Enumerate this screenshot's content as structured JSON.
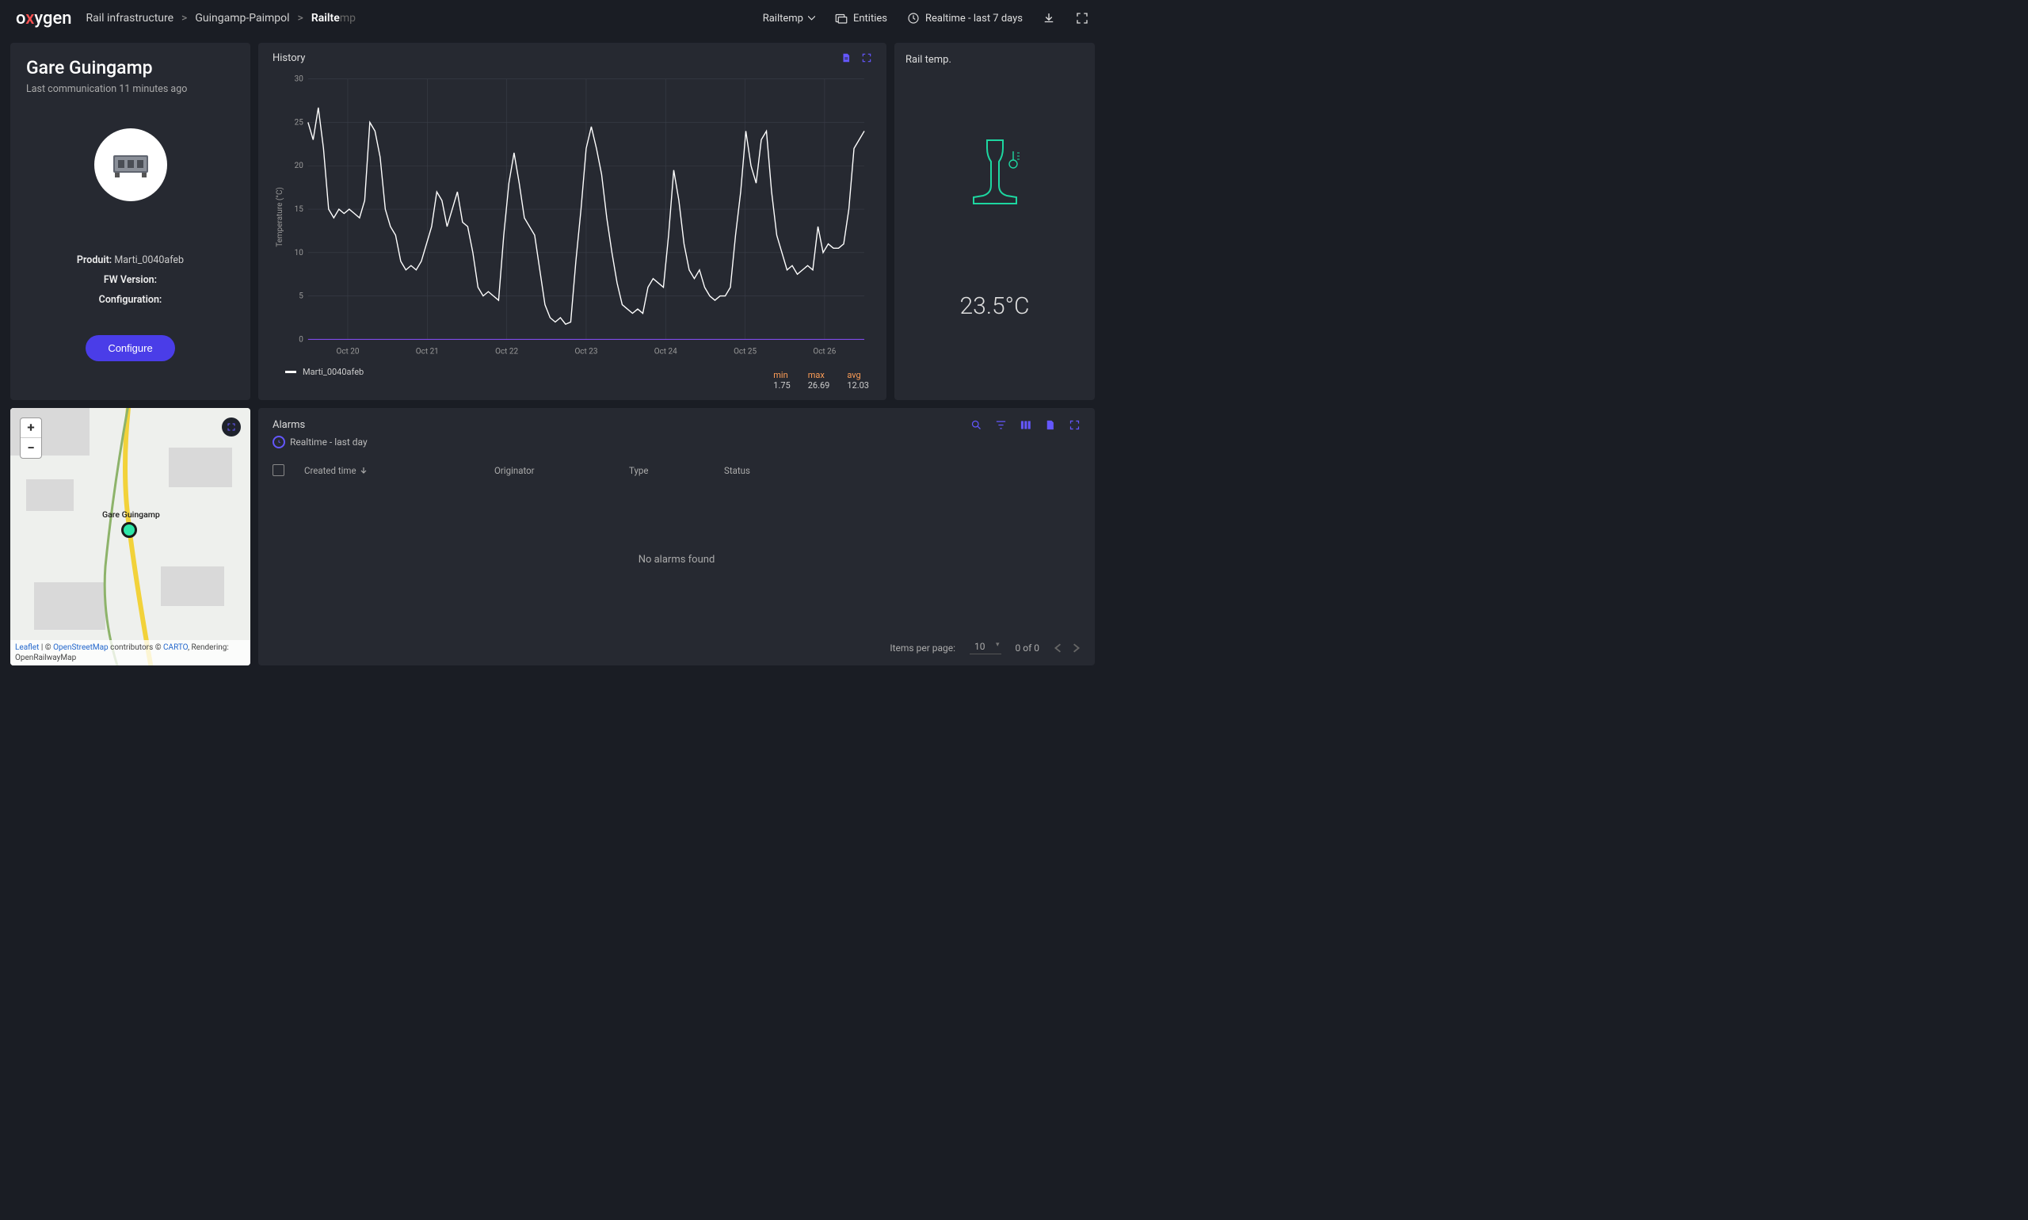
{
  "header": {
    "logo_o1": "o",
    "logo_x": "x",
    "logo_rest": "ygen",
    "crumb1": "Rail infrastructure",
    "crumb2": "Guingamp-Paimpol",
    "crumb3_strong": "Railte",
    "crumb3_faded": "mp",
    "entity_dropdown": "Railtemp",
    "entities_label": "Entities",
    "time_label": "Realtime - last 7 days"
  },
  "info": {
    "title": "Gare Guingamp",
    "subtitle": "Last communication 11 minutes ago",
    "product_label": "Produit:",
    "product_val": "Marti_0040afeb",
    "fw_label": "FW Version:",
    "conf_label": "Configuration:",
    "configure_btn": "Configure"
  },
  "chart": {
    "title": "History",
    "ylabel": "Temperature (°C)",
    "series_name": "Marti_0040afeb",
    "stats": {
      "min_label": "min",
      "min_val": "1.75",
      "max_label": "max",
      "max_val": "26.69",
      "avg_label": "avg",
      "avg_val": "12.03"
    }
  },
  "gauge": {
    "title": "Rail temp.",
    "value": "23.5°C"
  },
  "map": {
    "marker_label": "Gare Guingamp",
    "attrib_leaflet": "Leaflet",
    "attrib_osm": "OpenStreetMap",
    "attrib_mid": " | © ",
    "attrib_contrib": " contributors © ",
    "attrib_carto": "CARTO",
    "attrib_render": ", Rendering: OpenRailwayMap"
  },
  "alarms": {
    "title": "Alarms",
    "subtitle": "Realtime - last day",
    "col_created": "Created time",
    "col_originator": "Originator",
    "col_type": "Type",
    "col_status": "Status",
    "empty": "No alarms found",
    "ipp_label": "Items per page:",
    "ipp_val": "10",
    "range": "0 of 0"
  },
  "chart_data": {
    "type": "line",
    "title": "History",
    "ylabel": "Temperature (°C)",
    "ylim": [
      0,
      30
    ],
    "yticks": [
      0,
      5,
      10,
      15,
      20,
      25,
      30
    ],
    "xticks": [
      "Oct 20",
      "Oct 21",
      "Oct 22",
      "Oct 23",
      "Oct 24",
      "Oct 25",
      "Oct 26"
    ],
    "series": [
      {
        "name": "Marti_0040afeb",
        "values": [
          25,
          23,
          26.7,
          22,
          15,
          14,
          15,
          14.5,
          15,
          14.5,
          14,
          16,
          25,
          24,
          21,
          15,
          13,
          12,
          9,
          8,
          8.5,
          8,
          9,
          11,
          13,
          17,
          16,
          13,
          15,
          17,
          13.5,
          13,
          10,
          6,
          5,
          5.5,
          5,
          4.5,
          12,
          18,
          21.5,
          18,
          14,
          13,
          12,
          8,
          4,
          2.5,
          2,
          2.5,
          1.75,
          2,
          9,
          15,
          22,
          24.5,
          22,
          19,
          14,
          10,
          6.5,
          4,
          3.5,
          3,
          3.5,
          3,
          6,
          7,
          6.5,
          6,
          12,
          19.5,
          16,
          11,
          8,
          7,
          8,
          6,
          5,
          4.5,
          5,
          5,
          6,
          12,
          17,
          24,
          20,
          18,
          23,
          24,
          17,
          12,
          10,
          8,
          8.5,
          7.5,
          8,
          8.5,
          8,
          13,
          10,
          11,
          10.5,
          10.5,
          11,
          15,
          22,
          23,
          24
        ]
      }
    ],
    "stats": {
      "min": 1.75,
      "max": 26.69,
      "avg": 12.03
    }
  }
}
